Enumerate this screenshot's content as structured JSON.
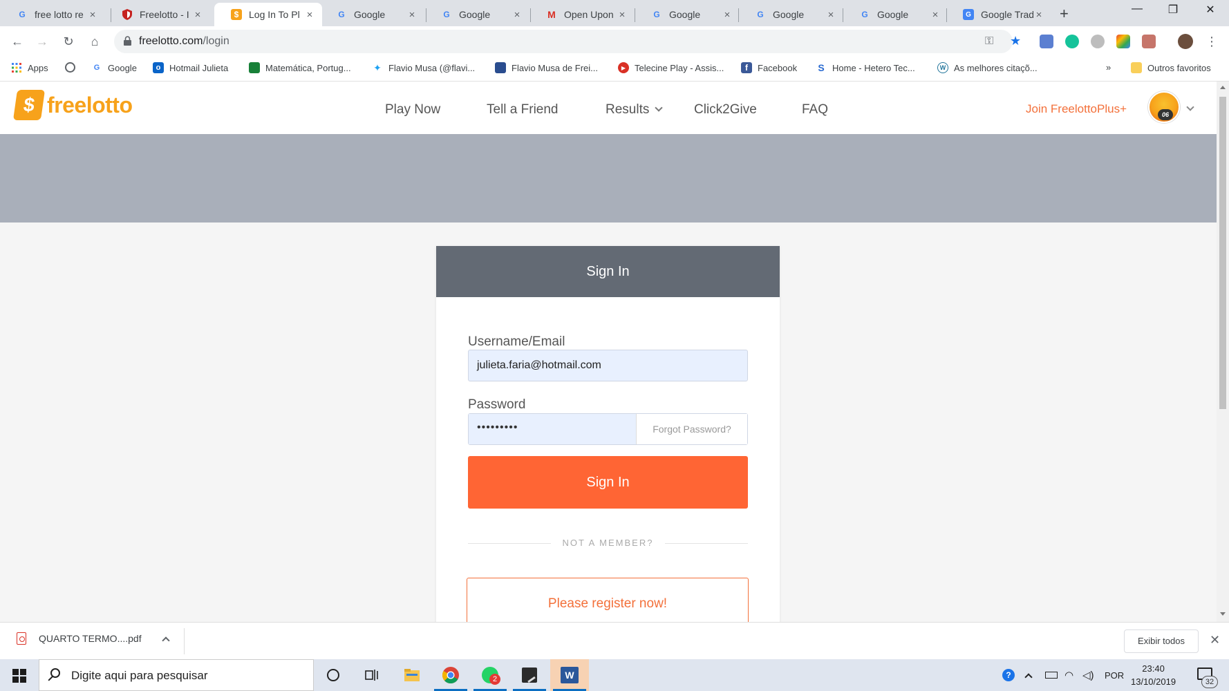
{
  "browser": {
    "tabs": [
      {
        "title": "free lotto re",
        "icon": "google-icon"
      },
      {
        "title": "Freelotto - I",
        "icon": "shield-icon"
      },
      {
        "title": "Log In To Pl",
        "icon": "freelotto-icon"
      },
      {
        "title": "Google",
        "icon": "google-icon"
      },
      {
        "title": "Google",
        "icon": "google-icon"
      },
      {
        "title": "Open Upon",
        "icon": "gmail-icon"
      },
      {
        "title": "Google",
        "icon": "google-icon"
      },
      {
        "title": "Google",
        "icon": "google-icon"
      },
      {
        "title": "Google",
        "icon": "google-icon"
      },
      {
        "title": "Google Trad",
        "icon": "google-translate-icon"
      }
    ],
    "active_tab": 2,
    "url_host": "freelotto.com",
    "url_path": "/login",
    "bookmarks": [
      {
        "label": "Apps",
        "icon": "apps-grid-icon"
      },
      {
        "label": "",
        "icon": "globe-icon"
      },
      {
        "label": "Google",
        "icon": "google-icon"
      },
      {
        "label": "Hotmail Julieta",
        "icon": "outlook-icon"
      },
      {
        "label": "Matemática, Portug...",
        "icon": "classroom-icon"
      },
      {
        "label": "Flavio Musa (@flavi...",
        "icon": "twitter-icon"
      },
      {
        "label": "Flavio Musa de Frei...",
        "icon": "lattes-icon"
      },
      {
        "label": "Telecine Play - Assis...",
        "icon": "play-icon"
      },
      {
        "label": "Facebook",
        "icon": "facebook-icon"
      },
      {
        "label": "Home - Hetero Tec...",
        "icon": "s-logo-icon"
      },
      {
        "label": "As melhores citaçõ...",
        "icon": "wordpress-icon"
      }
    ],
    "bookmarks_more": "»",
    "other_bookmarks": "Outros favoritos"
  },
  "site": {
    "logo_text": "freelotto",
    "logo_symbol": "$",
    "nav": [
      "Play Now",
      "Tell a Friend",
      "Results",
      "Click2Give",
      "FAQ"
    ],
    "join_label": "Join FreelottoPlus+",
    "avatar_badge": "06"
  },
  "login": {
    "title": "Sign In",
    "username_label": "Username/Email",
    "username_value": "julieta.faria@hotmail.com",
    "password_label": "Password",
    "password_value": "•••••••••",
    "forgot_label": "Forgot Password?",
    "signin_label": "Sign In",
    "divider_text": "NOT A MEMBER?",
    "register_label": "Please register now!"
  },
  "downloads": {
    "file_name": "QUARTO TERMO....pdf",
    "show_all": "Exibir todos"
  },
  "taskbar": {
    "search_placeholder": "Digite aqui para pesquisar",
    "whatsapp_badge": "2",
    "language": "POR",
    "time": "23:40",
    "date": "13/10/2019",
    "notification_count": "32"
  },
  "colors": {
    "brand_orange": "#ff6534",
    "logo_yellow": "#f7a21b",
    "card_header": "#636a74",
    "hero_band": "#a9afba"
  }
}
